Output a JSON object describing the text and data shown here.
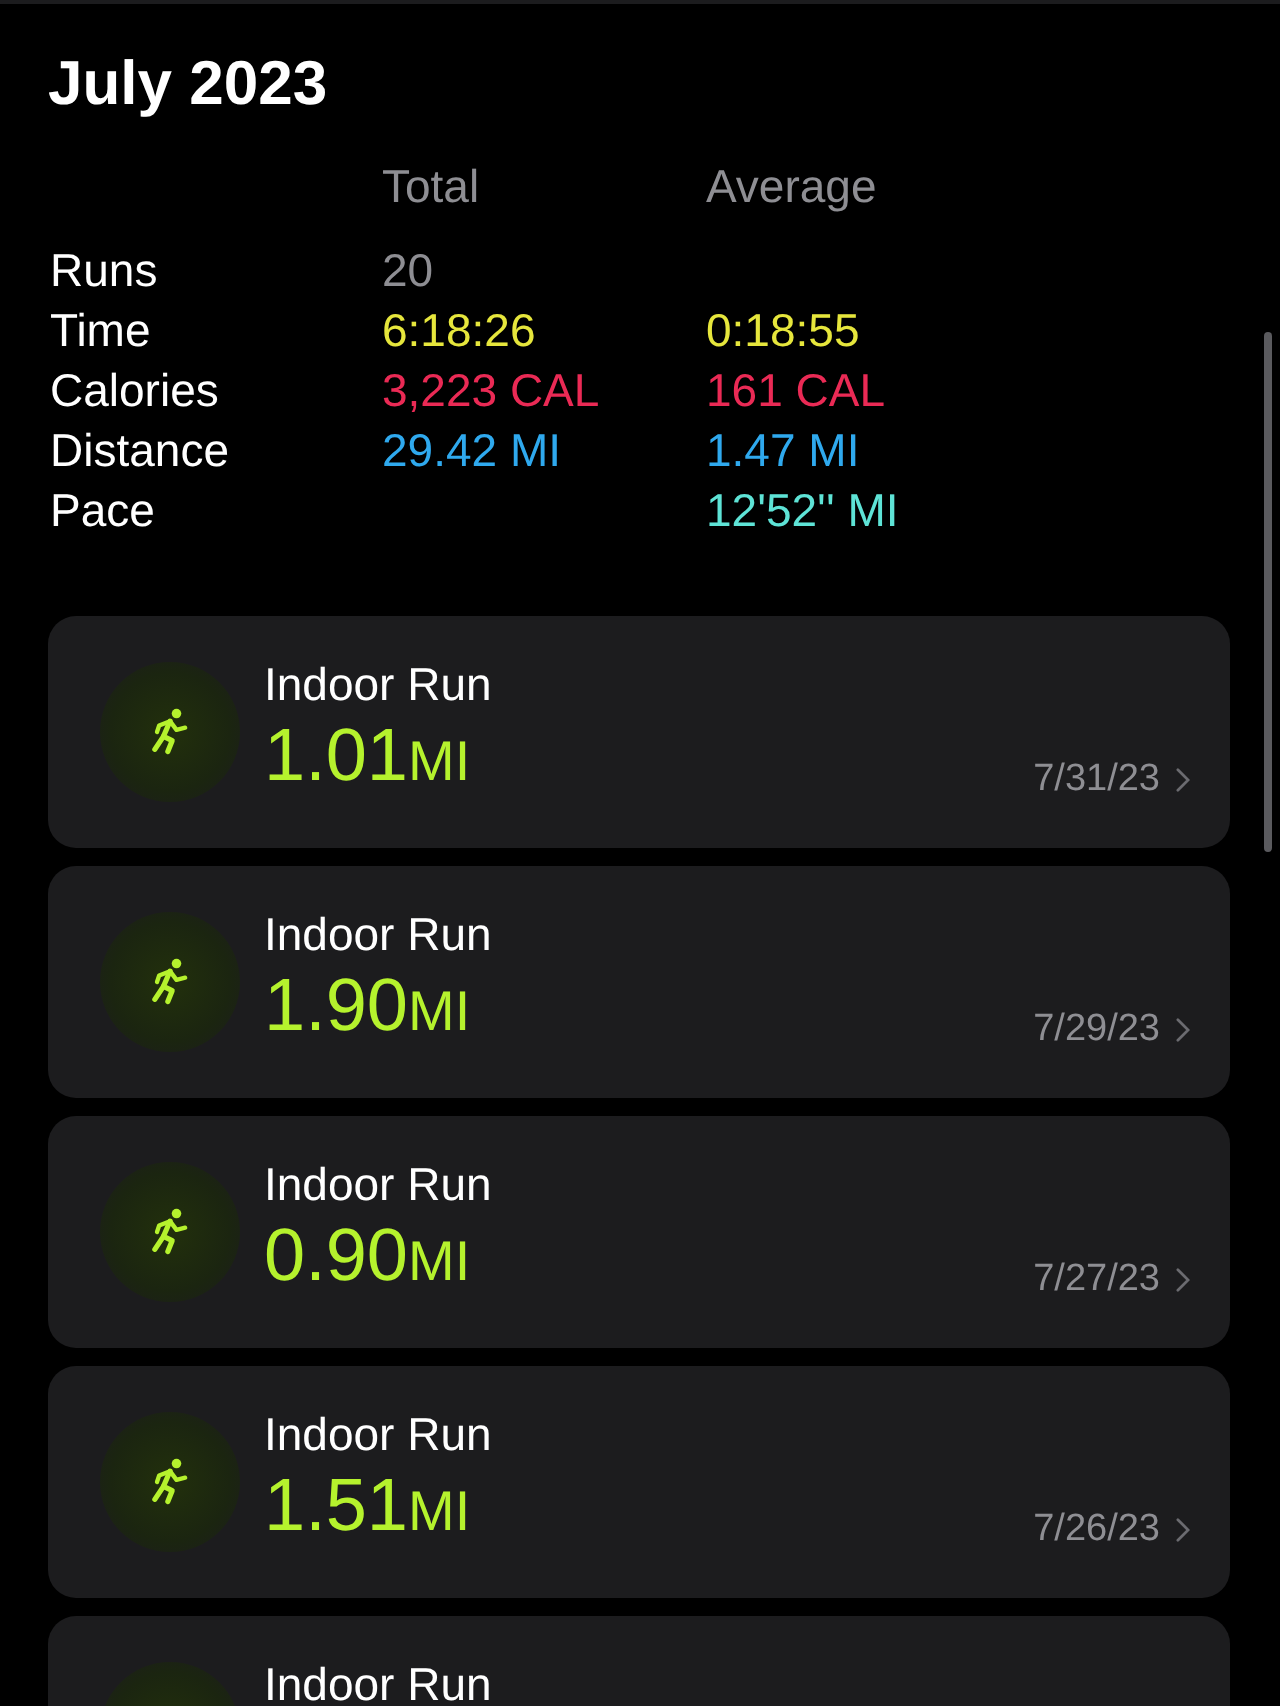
{
  "title": "July 2023",
  "summary": {
    "columns": [
      "Total",
      "Average"
    ],
    "rows": [
      {
        "label": "Runs",
        "total": "20",
        "color": "#8e8e93"
      },
      {
        "label": "Time",
        "total": "6:18:26",
        "average": "0:18:55",
        "color": "#e6e63c"
      },
      {
        "label": "Calories",
        "total": "3,223 CAL",
        "average": "161 CAL",
        "color": "#ea2a55"
      },
      {
        "label": "Distance",
        "total": "29.42 MI",
        "average": "1.47 MI",
        "color": "#2fa9ee"
      },
      {
        "label": "Pace",
        "average": "12'52'' MI",
        "color": "#5ee3d6"
      }
    ]
  },
  "workouts": [
    {
      "name": "Indoor Run",
      "distance": "1.01",
      "unit": "MI",
      "date": "7/31/23"
    },
    {
      "name": "Indoor Run",
      "distance": "1.90",
      "unit": "MI",
      "date": "7/29/23"
    },
    {
      "name": "Indoor Run",
      "distance": "0.90",
      "unit": "MI",
      "date": "7/27/23"
    },
    {
      "name": "Indoor Run",
      "distance": "1.51",
      "unit": "MI",
      "date": "7/26/23"
    },
    {
      "name": "Indoor Run"
    }
  ]
}
